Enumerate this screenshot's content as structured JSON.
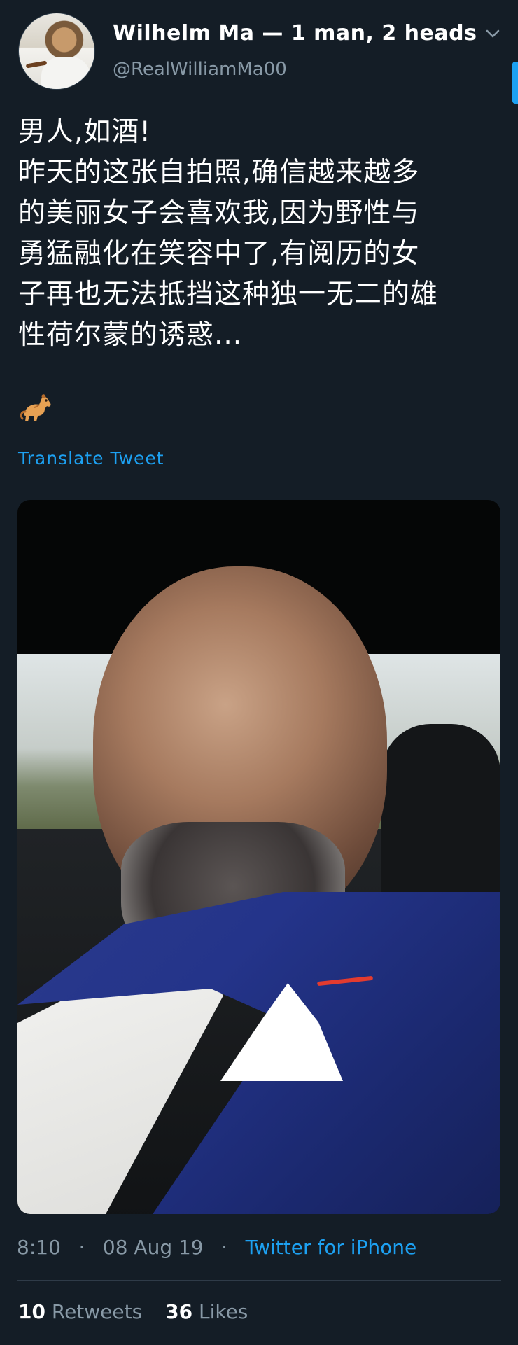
{
  "tweet": {
    "author": {
      "name": "Wilhelm Ma",
      "name_suffix": " — 1 man, 2 heads",
      "handle": "@RealWilliamMa00"
    },
    "text": "男人,如酒!\n昨天的这张自拍照,确信越来越多\n的美丽女子会喜欢我,因为野性与\n勇猛融化在笑容中了,有阅历的女\n子再也无法抵挡这种独一无二的雄\n性荷尔蒙的诱惑...",
    "emoji": "horse-emoji",
    "translate_label": "Translate Tweet",
    "time": "8:10",
    "date": "08 Aug 19",
    "source": "Twitter for iPhone",
    "retweets_count": "10",
    "retweets_label": "Retweets",
    "likes_count": "36",
    "likes_label": "Likes"
  },
  "icons": {
    "menu": "chevron-down-icon"
  },
  "colors": {
    "background": "#141d26",
    "link": "#1da1f2",
    "secondary_text": "#8899a6"
  }
}
